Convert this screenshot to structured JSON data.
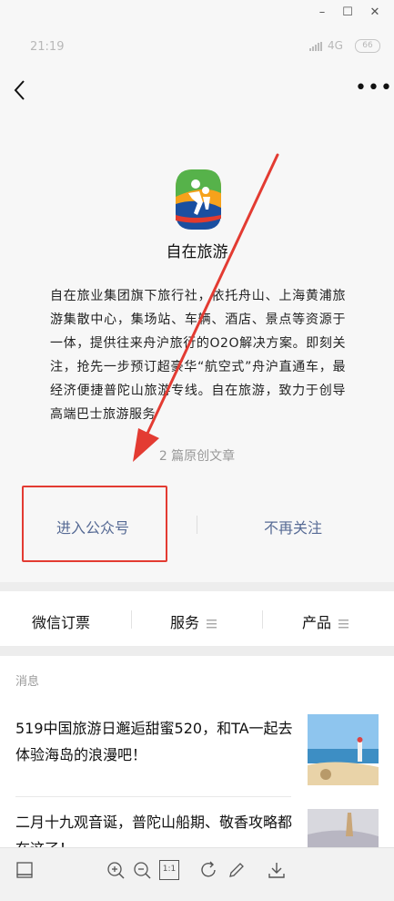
{
  "window": {
    "minimize": "–",
    "maximize": "☐",
    "close": "✕"
  },
  "status_bar": {
    "time": "21:19",
    "network": "4G",
    "battery": "66"
  },
  "nav": {
    "more": "•••"
  },
  "account": {
    "name": "自在旅游",
    "description": "自在旅业集团旗下旅行社，依托舟山、上海黄浦旅游集散中心，集场站、车辆、酒店、景点等资源于一体，提供往来舟沪旅行的O2O解决方案。即刻关注，抢先一步预订超豪华“航空式”舟沪直通车，最经济便捷普陀山旅游专线。自在旅游，致力于创导高端巴士旅游服务",
    "article_count": "2 篇原创文章"
  },
  "actions": {
    "enter": "进入公众号",
    "unfollow": "不再关注"
  },
  "menu": {
    "items": [
      "微信订票",
      "服务",
      "产品"
    ]
  },
  "messages": {
    "label": "消息",
    "items": [
      {
        "title": "519中国旅游日邂逅甜蜜520，和TA一起去体验海岛的浪漫吧！"
      },
      {
        "title": "二月十九观音诞，普陀山船期、敬香攻略都在这了！"
      }
    ]
  },
  "toolbar": {
    "items": [
      "layout-icon",
      "zoom-in-icon",
      "zoom-out-icon",
      "actual-size-icon",
      "rotate-icon",
      "edit-icon",
      "download-icon"
    ],
    "actual_size_label": "1:1"
  },
  "colors": {
    "link": "#576b95",
    "highlight": "#e33b32",
    "background": "#f7f7f7"
  }
}
